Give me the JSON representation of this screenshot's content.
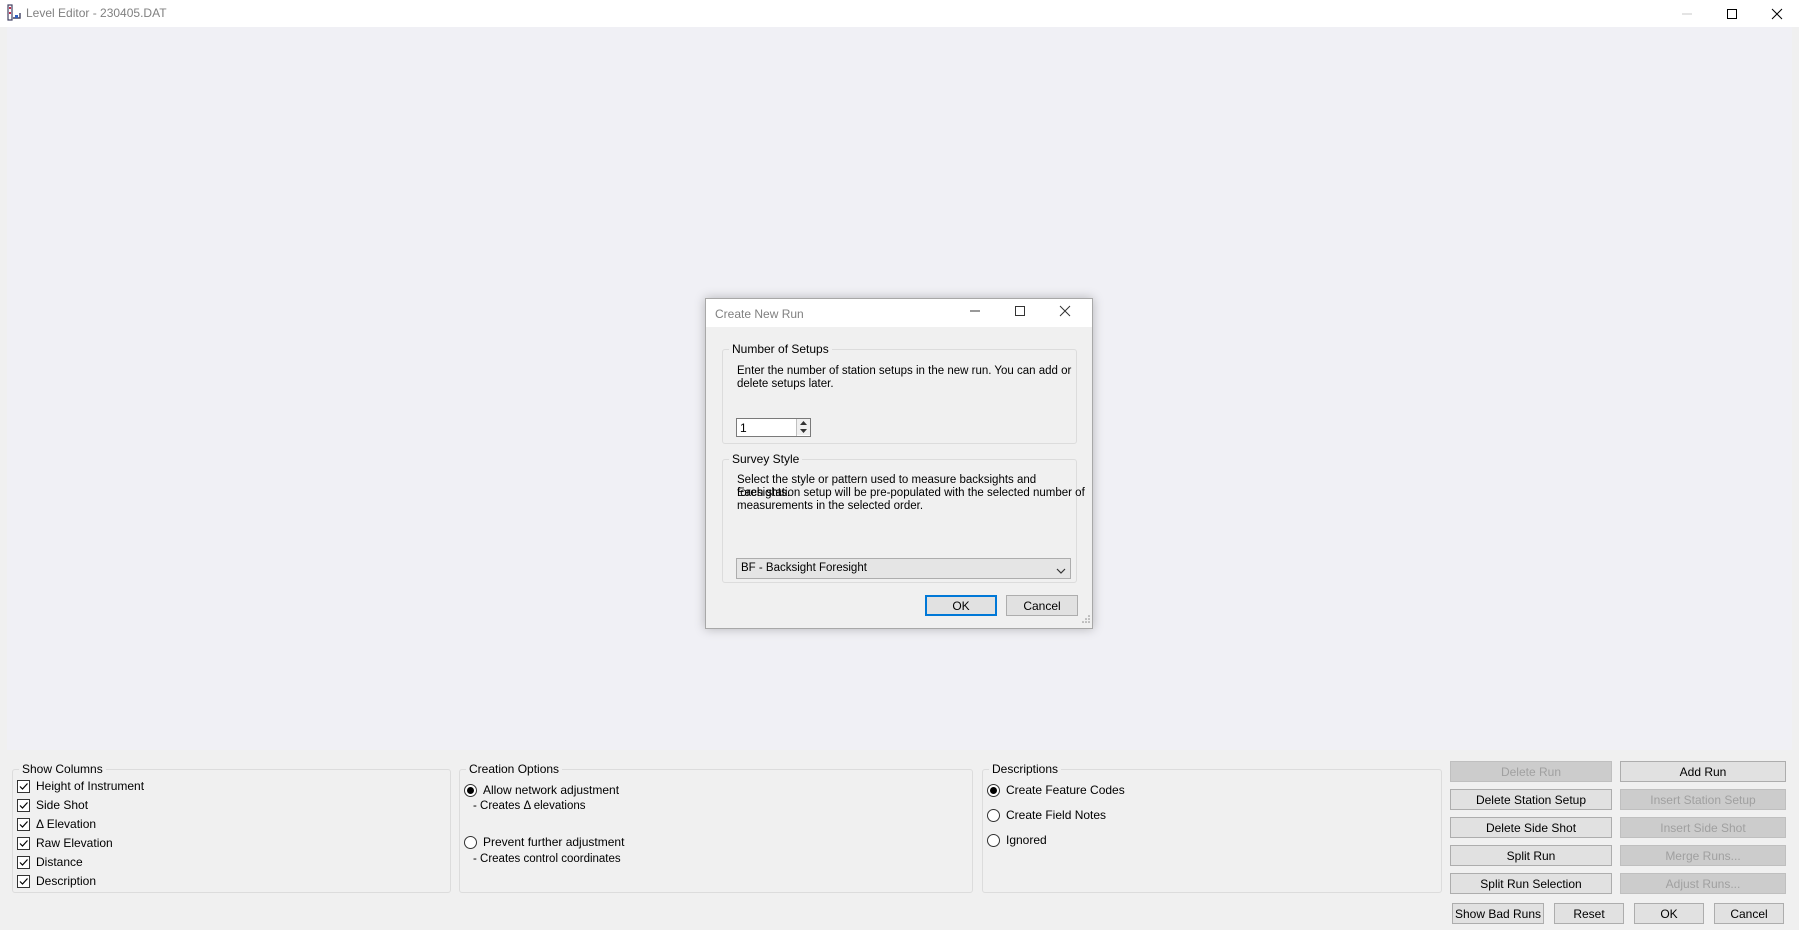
{
  "window": {
    "title": "Level Editor - 230405.DAT",
    "minimize_icon": "minimize-icon",
    "maximize_icon": "maximize-icon",
    "close_icon": "close-icon"
  },
  "show_columns": {
    "label": "Show Columns",
    "items": [
      {
        "label": "Height of Instrument",
        "checked": true
      },
      {
        "label": "Side Shot",
        "checked": true
      },
      {
        "label": "Δ Elevation",
        "checked": true
      },
      {
        "label": "Raw Elevation",
        "checked": true
      },
      {
        "label": "Distance",
        "checked": true
      },
      {
        "label": "Description",
        "checked": true
      }
    ]
  },
  "creation_options": {
    "label": "Creation Options",
    "options": [
      {
        "label": "Allow network adjustment",
        "note": "- Creates Δ elevations",
        "selected": true
      },
      {
        "label": "Prevent further adjustment",
        "note": "- Creates control coordinates",
        "selected": false
      }
    ]
  },
  "descriptions": {
    "label": "Descriptions",
    "options": [
      {
        "label": "Create Feature Codes",
        "selected": true
      },
      {
        "label": "Create Field Notes",
        "selected": false
      },
      {
        "label": "Ignored",
        "selected": false
      }
    ]
  },
  "actions": {
    "delete_run": "Delete Run",
    "add_run": "Add Run",
    "delete_station_setup": "Delete Station Setup",
    "insert_station_setup": "Insert Station Setup",
    "delete_side_shot": "Delete Side Shot",
    "insert_side_shot": "Insert Side Shot",
    "split_run": "Split Run",
    "merge_runs": "Merge Runs...",
    "split_run_selection": "Split Run Selection",
    "adjust_runs": "Adjust Runs..."
  },
  "footer": {
    "show_bad_runs": "Show Bad Runs",
    "reset": "Reset",
    "ok": "OK",
    "cancel": "Cancel"
  },
  "dialog": {
    "title": "Create New Run",
    "setups_group": "Number of Setups",
    "setups_desc_1": "Enter the number of station setups in the new run. You can add or",
    "setups_desc_2": "delete setups later.",
    "setups_value": "1",
    "style_group": "Survey Style",
    "style_desc_1": "Select the style or pattern used to measure backsights and foresights.",
    "style_desc_2": "Each station setup will be pre-populated with the selected number of",
    "style_desc_3": "measurements in the selected order.",
    "style_value": "BF - Backsight Foresight",
    "ok": "OK",
    "cancel": "Cancel"
  }
}
